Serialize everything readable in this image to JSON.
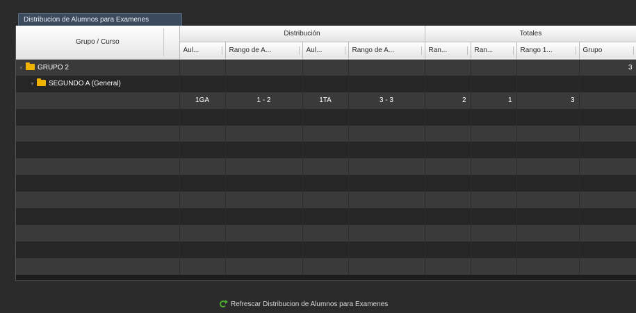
{
  "tab": {
    "label": "Distribucion de Alumnos para Examenes"
  },
  "header": {
    "group_course": "Grupo / Curso",
    "distribucion": "Distribución",
    "totales": "Totales",
    "sub": [
      "Aul...",
      "Rango de A...",
      "Aul...",
      "Rango de A...",
      "Ran...",
      "Ran...",
      "Rango 1...",
      "Grupo"
    ]
  },
  "rows": [
    {
      "label": "GRUPO 2",
      "level": 1,
      "cells": [
        "",
        "",
        "",
        "",
        "",
        "",
        "",
        "3"
      ]
    },
    {
      "label": "SEGUNDO A (General)",
      "level": 2,
      "cells": [
        "",
        "",
        "",
        "",
        "",
        "",
        "",
        ""
      ]
    },
    {
      "label": "",
      "level": 0,
      "cells": [
        "1GA",
        "1 - 2",
        "1TA",
        "3 - 3",
        "2",
        "1",
        "3",
        ""
      ]
    }
  ],
  "refresh": {
    "label": "Refrescar Distribucion de Alumnos para Examenes"
  },
  "colors": {
    "folder": "#f0b400",
    "refresh_icon": "#4caf2a"
  }
}
